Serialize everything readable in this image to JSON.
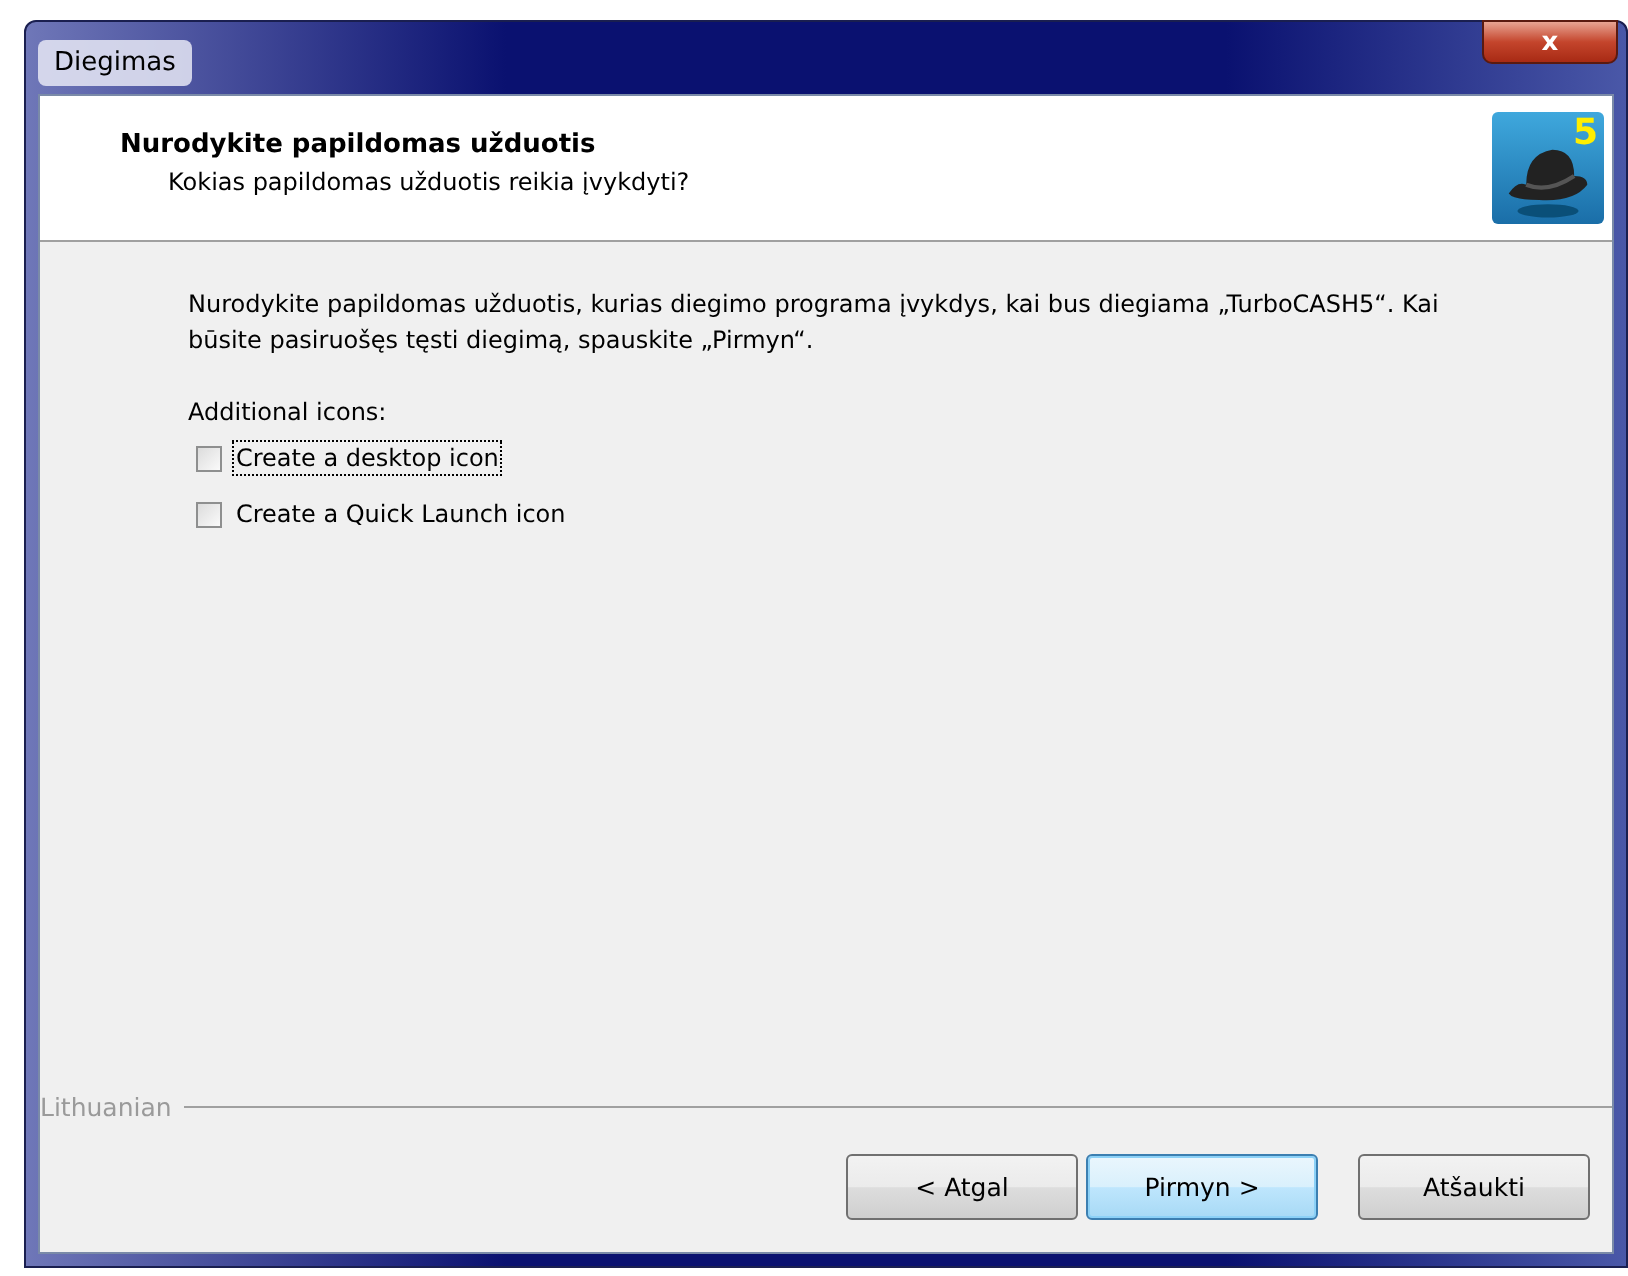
{
  "window": {
    "title": "Diegimas",
    "close": "x"
  },
  "header": {
    "title": "Nurodykite papildomas užduotis",
    "subtitle": "Kokias papildomas užduotis reikia įvykdyti?",
    "badge": "5"
  },
  "description": "Nurodykite papildomas užduotis, kurias diegimo programa įvykdys, kai bus diegiama „TurboCASH5“. Kai būsite pasiruošęs tęsti diegimą, spauskite „Pirmyn“.",
  "group_label": "Additional icons:",
  "options": [
    {
      "label": "Create a desktop icon",
      "checked": false,
      "focused": true
    },
    {
      "label": "Create a Quick Launch icon",
      "checked": false,
      "focused": false
    }
  ],
  "language": "Lithuanian",
  "buttons": [
    {
      "label": "< Atgal",
      "default": false
    },
    {
      "label": "Pirmyn >",
      "default": true
    },
    {
      "label": "Atšaukti",
      "default": false
    }
  ]
}
